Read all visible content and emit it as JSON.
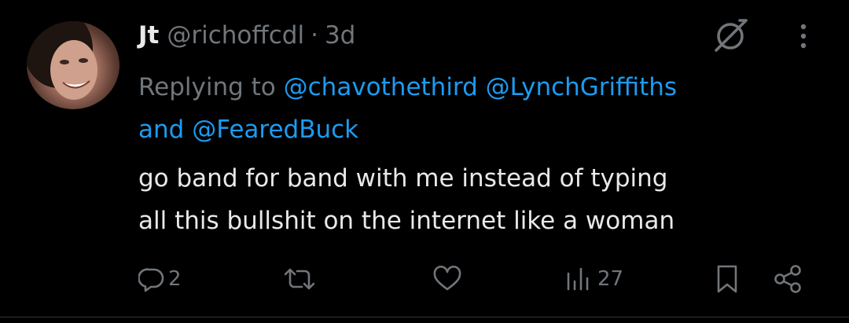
{
  "tweet": {
    "display_name": "Jt",
    "handle": "@richoffcdl",
    "separator": "·",
    "time": "3d",
    "replying_prefix": "Replying to",
    "mention_1": "@chavothethird",
    "mention_2": "@LynchGriffiths",
    "mention_and": "and",
    "mention_3": "@FearedBuck",
    "text_line_1": "go band for band with me instead of typing",
    "text_line_2": "all this bullshit on the internet like a woman"
  },
  "actions": {
    "reply_count": "2",
    "repost_count": "",
    "like_count": "",
    "views_count": "27"
  },
  "icons": {
    "grok": "grok-icon",
    "more": "more-dots-icon",
    "reply": "reply-bubble-icon",
    "repost": "repost-icon",
    "like": "heart-icon",
    "views": "views-bars-icon",
    "bookmark": "bookmark-icon",
    "share": "share-icon"
  },
  "colors": {
    "background": "#000000",
    "primary_text": "#e7e9ea",
    "secondary_text": "#71767b",
    "link": "#1d9bf0"
  }
}
